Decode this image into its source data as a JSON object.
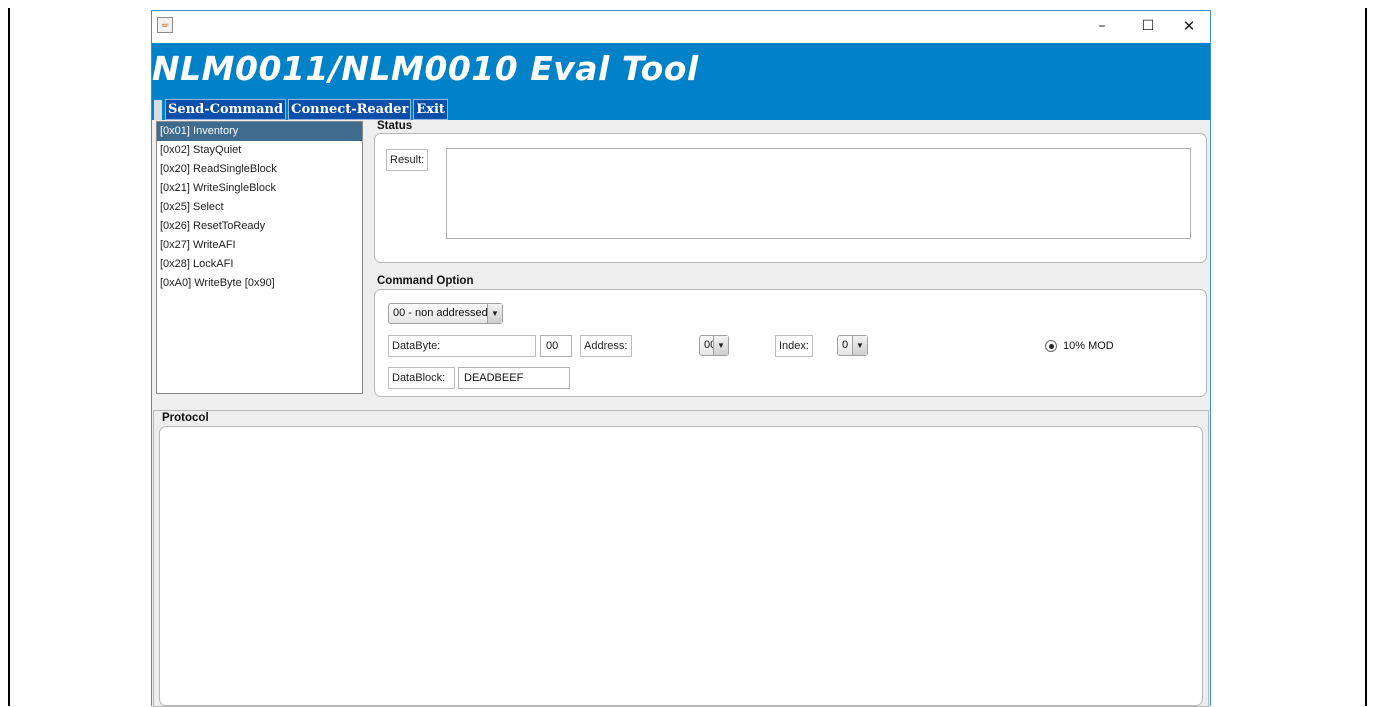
{
  "window": {
    "java_icon": "java-cup-icon",
    "minimize": "–",
    "maximize": "☐",
    "close": "✕"
  },
  "banner": {
    "title": "NLM0011/NLM0010 Eval Tool",
    "color": "#0081c8"
  },
  "menu": {
    "items": [
      "Send-Command",
      "Connect-Reader",
      "Exit"
    ]
  },
  "commands": {
    "items": [
      "[0x01] Inventory",
      "[0x02] StayQuiet",
      "[0x20] ReadSingleBlock",
      "[0x21] WriteSingleBlock",
      "[0x25] Select",
      "[0x26] ResetToReady",
      "[0x27] WriteAFI",
      "[0x28] LockAFI",
      "[0xA0] WriteByte [0x90]"
    ],
    "selected_index": 0
  },
  "status": {
    "title": "Status",
    "result_label": "Result:",
    "result_value": ""
  },
  "command_option": {
    "title": "Command Option",
    "address_mode": "00 - non addressed",
    "databyte_label": "DataByte:",
    "databyte_value": "00",
    "address_label": "Address:",
    "address_value": "00",
    "index_label": "Index:",
    "index_value": "0",
    "mod_option": "10% MOD",
    "mod_selected": true,
    "datablock_label": "DataBlock:",
    "datablock_value": "DEADBEEF",
    "combo_arrow": "▼"
  },
  "protocol": {
    "title": "Protocol",
    "content": ""
  }
}
